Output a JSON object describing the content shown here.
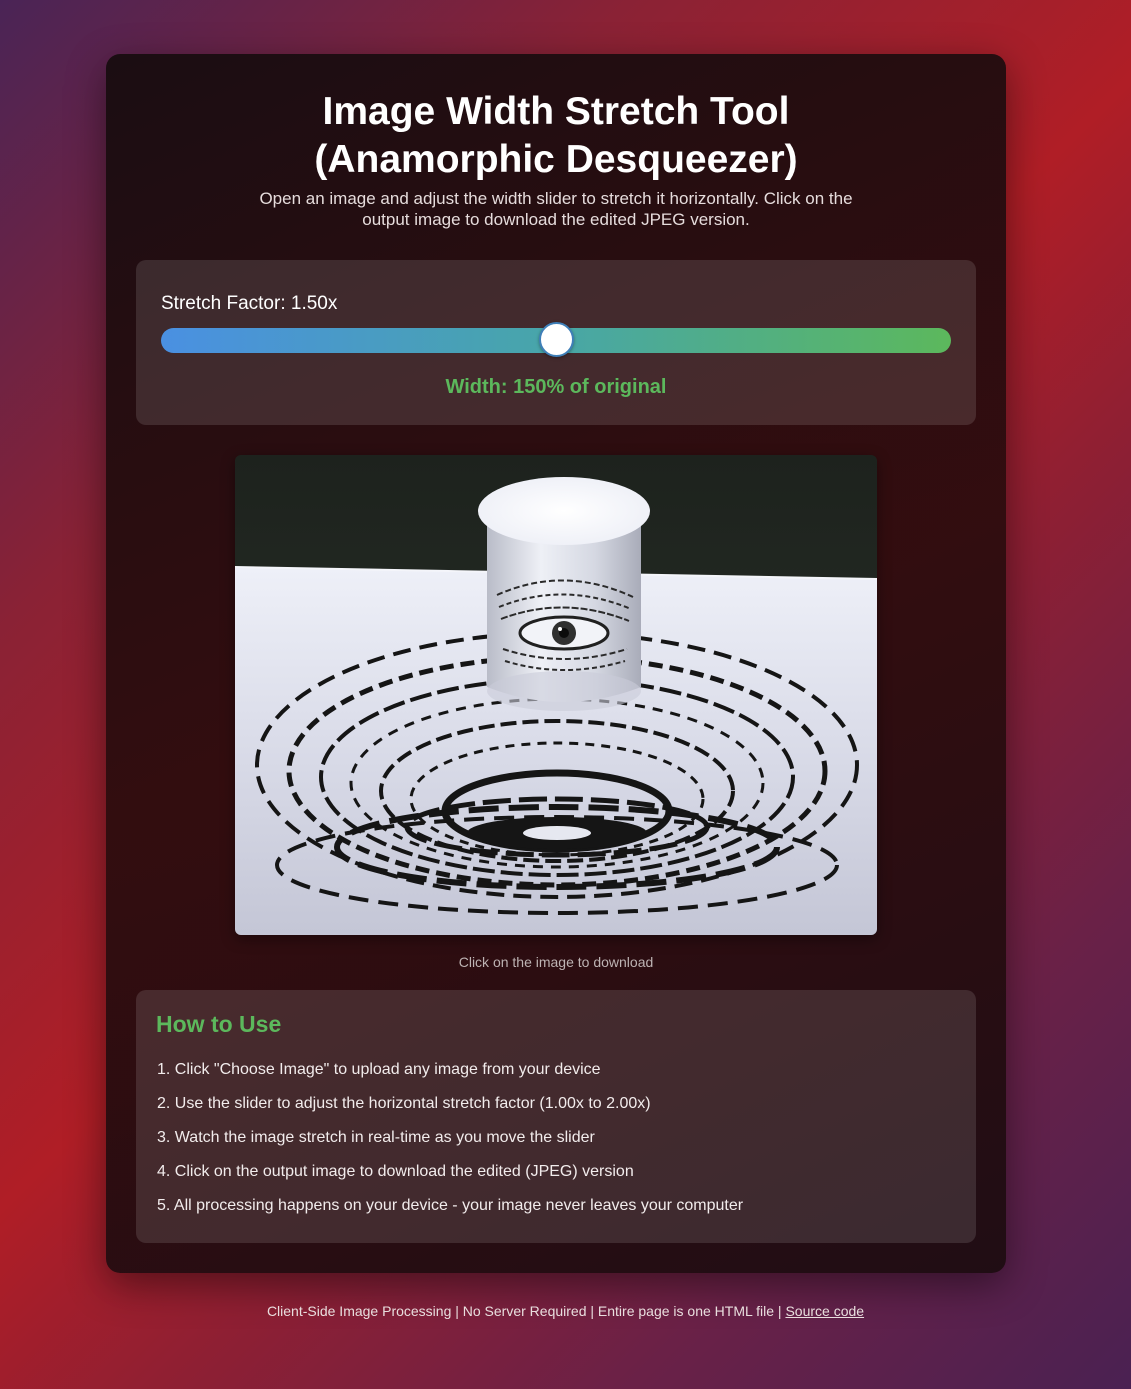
{
  "header": {
    "title_line1": "Image Width Stretch Tool",
    "title_line2": "(Anamorphic Desqueezer)",
    "subtitle": "Open an image and adjust the width slider to stretch it horizontally. Click on the output image to download the edited JPEG version."
  },
  "controls": {
    "stretch_label_prefix": "Stretch Factor: ",
    "stretch_value_text": "1.50x",
    "slider": {
      "min": 1.0,
      "max": 2.0,
      "value": 1.5
    },
    "width_readout": "Width: 150% of original",
    "colors": {
      "track_start": "#4a90e2",
      "track_end": "#5cb85c",
      "accent": "#5cb85c"
    }
  },
  "output": {
    "download_hint": "Click on the image to download"
  },
  "howto": {
    "title": "How to Use",
    "steps": [
      "1. Click \"Choose Image\" to upload any image from your device",
      "2. Use the slider to adjust the horizontal stretch factor (1.00x to 2.00x)",
      "3. Watch the image stretch in real-time as you move the slider",
      "4. Click on the output image to download the edited (JPEG) version",
      "5. All processing happens on your device - your image never leaves your computer"
    ]
  },
  "footer": {
    "text": "Client-Side Image Processing | No Server Required | Entire page is one HTML file | ",
    "link": "Source code"
  }
}
